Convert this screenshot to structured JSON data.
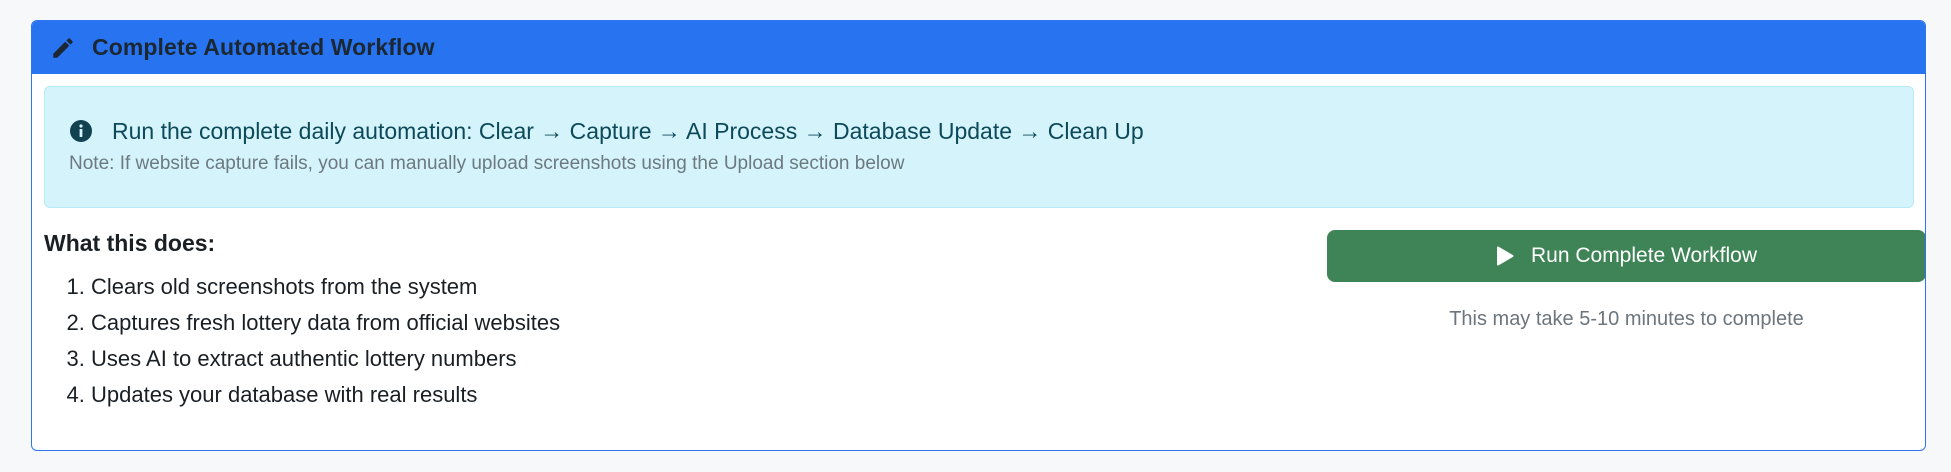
{
  "card": {
    "title": "Complete Automated Workflow",
    "title_icon": "pencil-icon"
  },
  "alert": {
    "icon": "info-icon",
    "message": "Run the complete daily automation: Clear → Capture → AI Process → Database Update → Clean Up",
    "note": "Note: If website capture fails, you can manually upload screenshots using the Upload section below"
  },
  "steps": {
    "heading": "What this does:",
    "items": [
      "Clears old screenshots from the system",
      "Captures fresh lottery data from official websites",
      "Uses AI to extract authentic lottery numbers",
      "Updates your database with real results"
    ]
  },
  "action": {
    "button_label": "Run Complete Workflow",
    "button_icon": "play-icon",
    "hint": "This may take 5-10 minutes to complete"
  },
  "colors": {
    "header": "#2874f0",
    "alert_bg": "#d4f3fb",
    "button": "#3e8456"
  }
}
